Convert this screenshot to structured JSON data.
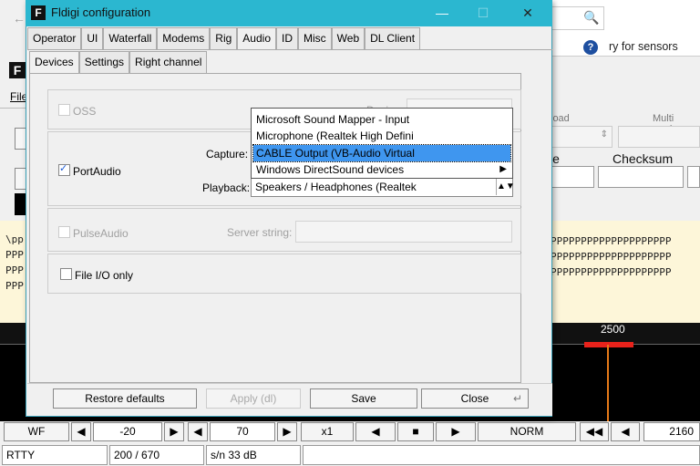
{
  "background_browser": {
    "help_link": "ry for sensors",
    "help_icon": "?",
    "search_icon": "🔍"
  },
  "main_window": {
    "menu_file": "File",
    "receive_text_left": "\\pp\nPPP\nPPP\nPPP",
    "receive_text_right": "PPPPPPPPPPPPPPPPPPPP\nPPPPPPPPPPPPPPPPPPPP\nPPPPPPPPPPPPPPPPPPPP",
    "right_labels": {
      "load": "load",
      "multi_mode": "Multi mode",
      "le": "le",
      "checksum": "Checksum"
    },
    "waterfall_tick": "2500",
    "bottom_bar": {
      "wf": "WF",
      "left_arrow": "◀",
      "offset_value": "-20",
      "right_arrow": "▶",
      "left_arrow2": "◀",
      "level_value": "70",
      "right_arrow2": "▶",
      "zoom": "x1",
      "rev": "◀",
      "stop": "■",
      "fwd": "▶",
      "norm": "NORM",
      "fast_rev": "◀◀",
      "step_back": "◀",
      "frequency": "2160"
    },
    "status_bar": {
      "mode": "RTTY",
      "bandwidth": "200 / 670",
      "snr": "s/n  33 dB"
    }
  },
  "dialog": {
    "title": "Fldigi configuration",
    "controls": {
      "minimize": "—",
      "maximize": "☐",
      "close": "✕"
    },
    "tabs": [
      "Operator",
      "UI",
      "Waterfall",
      "Modems",
      "Rig",
      "Audio",
      "ID",
      "Misc",
      "Web",
      "DL Client"
    ],
    "active_tab": "Audio",
    "subtabs": [
      "Devices",
      "Settings",
      "Right channel"
    ],
    "active_subtab": "Devices",
    "oss": {
      "label": "OSS",
      "device_label": "Device:"
    },
    "portaudio": {
      "label": "PortAudio",
      "checked": true,
      "capture_label": "Capture:",
      "playback_label": "Playback:",
      "playback_value": "Speakers / Headphones (Realtek"
    },
    "capture_dropdown": {
      "options": [
        "Microsoft Sound Mapper - Input",
        "Microphone (Realtek High Defini",
        "CABLE Output (VB-Audio Virtual",
        "Windows DirectSound devices"
      ],
      "selected_index": 2
    },
    "pulseaudio": {
      "label": "PulseAudio",
      "server_label": "Server string:",
      "server_value": ""
    },
    "fileio": {
      "label": "File I/O only",
      "checked": false
    },
    "buttons": {
      "restore": "Restore defaults",
      "apply": "Apply (dl)",
      "save": "Save",
      "close": "Close",
      "close_icon": "↵"
    }
  }
}
